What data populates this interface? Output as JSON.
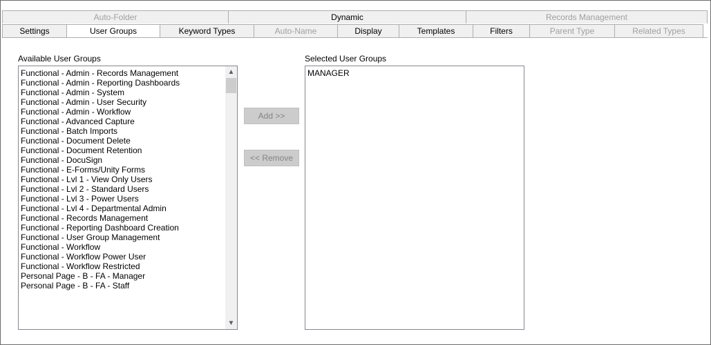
{
  "tabs_back": [
    {
      "label": "Auto-Folder",
      "state": "disabled"
    },
    {
      "label": "Dynamic",
      "state": "enabled"
    },
    {
      "label": "Records Management",
      "state": "disabled"
    }
  ],
  "tabs_front": [
    {
      "label": "Settings",
      "state": "enabled"
    },
    {
      "label": "User Groups",
      "state": "selected"
    },
    {
      "label": "Keyword Types",
      "state": "enabled"
    },
    {
      "label": "Auto-Name",
      "state": "disabled"
    },
    {
      "label": "Display",
      "state": "enabled"
    },
    {
      "label": "Templates",
      "state": "enabled"
    },
    {
      "label": "Filters",
      "state": "enabled"
    },
    {
      "label": "Parent Type",
      "state": "disabled"
    },
    {
      "label": "Related Types",
      "state": "disabled"
    }
  ],
  "available": {
    "label": "Available User Groups",
    "items": [
      "Functional - Admin - Records Management",
      "Functional - Admin - Reporting Dashboards",
      "Functional - Admin - System",
      "Functional - Admin - User Security",
      "Functional - Admin - Workflow",
      "Functional - Advanced Capture",
      "Functional - Batch Imports",
      "Functional - Document Delete",
      "Functional - Document Retention",
      "Functional - DocuSign",
      "Functional - E-Forms/Unity Forms",
      "Functional - Lvl 1 - View Only Users",
      "Functional - Lvl 2 - Standard Users",
      "Functional - Lvl 3 - Power Users",
      "Functional - Lvl 4 - Departmental Admin",
      "Functional - Records Management",
      "Functional - Reporting Dashboard Creation",
      "Functional - User Group Management",
      "Functional - Workflow",
      "Functional - Workflow Power User",
      "Functional - Workflow Restricted",
      "Personal Page - B - FA - Manager",
      "Personal Page - B - FA - Staff"
    ],
    "scroll_up_icon": "▲",
    "scroll_down_icon": "▼"
  },
  "buttons": {
    "add": "Add >>",
    "remove": "<< Remove"
  },
  "selected": {
    "label": "Selected User Groups",
    "items": [
      "MANAGER"
    ]
  }
}
